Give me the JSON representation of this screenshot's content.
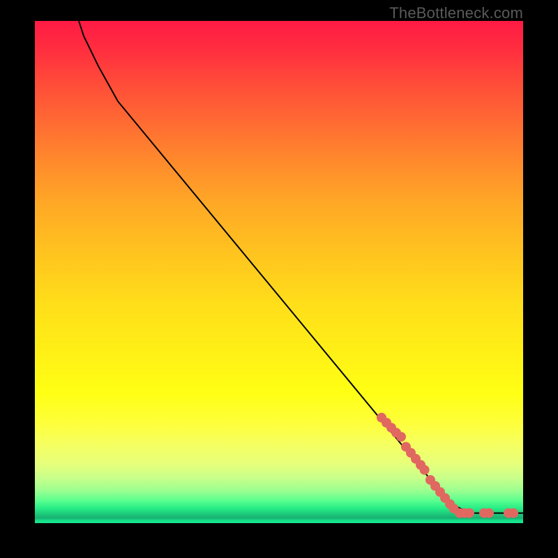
{
  "watermark": "TheBottleneck.com",
  "chart_data": {
    "type": "scatter",
    "title": "",
    "xlabel": "",
    "ylabel": "",
    "xlim": [
      0,
      100
    ],
    "ylim": [
      0,
      100
    ],
    "grid": false,
    "legend": false,
    "background_gradient": {
      "top": "#ff1a44",
      "bottom": "#18e88e"
    },
    "curve": {
      "color": "#000000",
      "width": 2,
      "points": [
        {
          "x": 9,
          "y": 100
        },
        {
          "x": 10,
          "y": 97
        },
        {
          "x": 13,
          "y": 91
        },
        {
          "x": 17,
          "y": 84
        },
        {
          "x": 85,
          "y": 4
        },
        {
          "x": 89,
          "y": 2
        },
        {
          "x": 100,
          "y": 2
        }
      ]
    },
    "series": [
      {
        "name": "markers",
        "color": "#e06860",
        "radius": 7,
        "points": [
          {
            "x": 71,
            "y": 21
          },
          {
            "x": 72,
            "y": 20
          },
          {
            "x": 73,
            "y": 19
          },
          {
            "x": 74,
            "y": 18
          },
          {
            "x": 75,
            "y": 17.2
          },
          {
            "x": 76,
            "y": 15.2
          },
          {
            "x": 77,
            "y": 14
          },
          {
            "x": 78,
            "y": 12.8
          },
          {
            "x": 79,
            "y": 11.6
          },
          {
            "x": 79.8,
            "y": 10.6
          },
          {
            "x": 81,
            "y": 8.6
          },
          {
            "x": 82,
            "y": 7.4
          },
          {
            "x": 83,
            "y": 6.2
          },
          {
            "x": 84,
            "y": 5
          },
          {
            "x": 85,
            "y": 3.8
          },
          {
            "x": 85.8,
            "y": 2.9
          },
          {
            "x": 87,
            "y": 2
          },
          {
            "x": 88,
            "y": 2
          },
          {
            "x": 89,
            "y": 2
          },
          {
            "x": 92,
            "y": 2
          },
          {
            "x": 93,
            "y": 2
          },
          {
            "x": 97,
            "y": 2
          },
          {
            "x": 98,
            "y": 2
          }
        ]
      }
    ]
  }
}
